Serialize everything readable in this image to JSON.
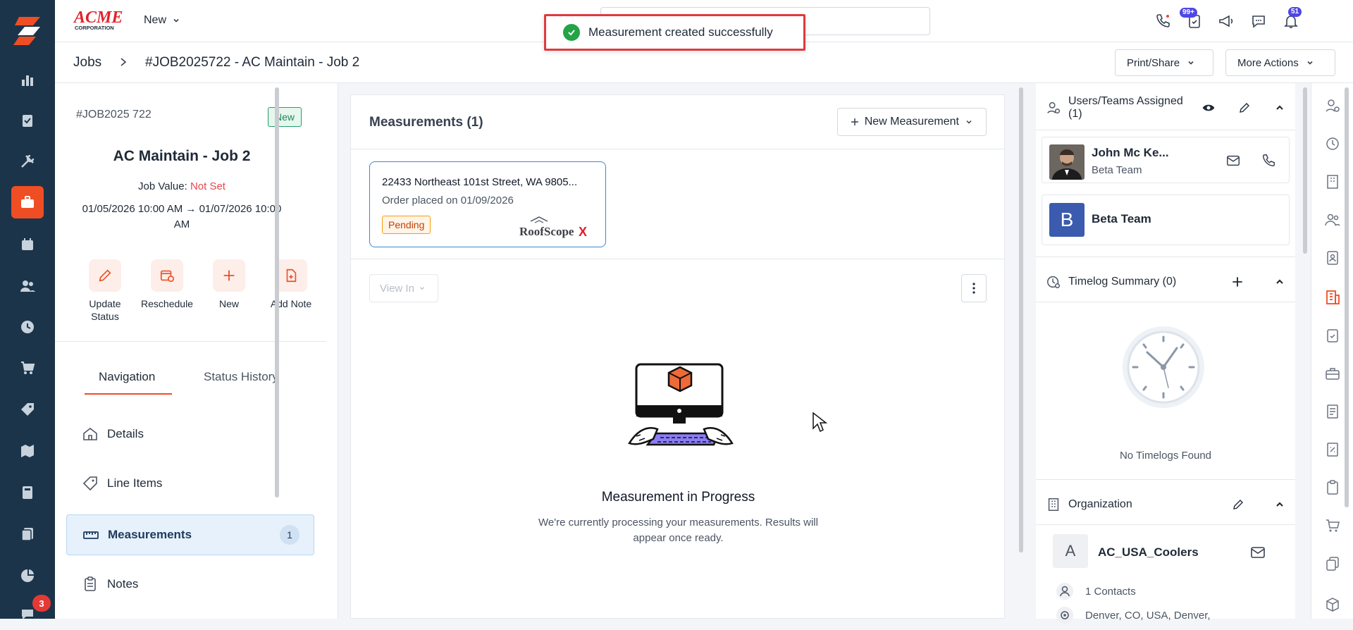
{
  "topbar": {
    "logo_text": "ACME",
    "logo_sub": "CORPORATION",
    "new_label": "New",
    "notif_badge_tasks": "99+",
    "notif_badge_bell": "51"
  },
  "toast": {
    "message": "Measurement created successfully"
  },
  "breadcrumb": {
    "root": "Jobs",
    "current": "#JOB2025722 - AC Maintain - Job 2",
    "print_share": "Print/Share",
    "more_actions": "More Actions"
  },
  "rail": {
    "chat_badge": "3"
  },
  "job": {
    "number": "#JOB2025 722",
    "status": "New",
    "name": "AC Maintain - Job 2",
    "value_label": "Job Value:",
    "value": "Not Set",
    "dates_line1": "01/05/2026 10:00 AM → 01/07/2026 10:00",
    "dates_line2": "AM",
    "actions": [
      {
        "label1": "Update",
        "label2": "Status"
      },
      {
        "label1": "Reschedule",
        "label2": ""
      },
      {
        "label1": "New",
        "label2": ""
      },
      {
        "label1": "Add Note",
        "label2": ""
      }
    ],
    "tabs": [
      "Navigation",
      "Status History"
    ],
    "nav": [
      {
        "label": "Details"
      },
      {
        "label": "Line Items"
      },
      {
        "label": "Measurements",
        "count": "1"
      },
      {
        "label": "Notes"
      }
    ]
  },
  "measurements": {
    "title": "Measurements (1)",
    "new_button": "New Measurement",
    "card": {
      "address": "22433 Northeast 101st Street, WA 9805...",
      "order": "Order placed on 01/09/2026",
      "status": "Pending",
      "provider": "RoofScopeX"
    },
    "view_in": "View In",
    "empty_title": "Measurement in Progress",
    "empty_sub_1": "We're currently processing your measurements. Results will",
    "empty_sub_2": "appear once ready."
  },
  "right": {
    "users_title": "Users/Teams Assigned (1)",
    "user_name": "John Mc Ke...",
    "user_team": "Beta Team",
    "team_initial": "B",
    "team_name": "Beta Team",
    "timelog_title": "Timelog Summary (0)",
    "timelog_empty": "No Timelogs Found",
    "org_title": "Organization",
    "org_initial": "A",
    "org_name": "AC_USA_Coolers",
    "org_contacts": "1 Contacts",
    "org_address": "Denver, CO, USA, Denver,"
  },
  "colors": {
    "accent": "#ef4e24",
    "rail": "#1c3449",
    "link": "#3d86d8"
  }
}
